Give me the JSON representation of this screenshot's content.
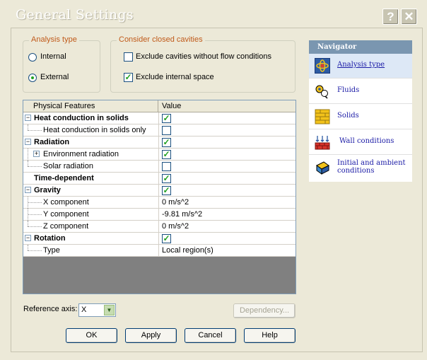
{
  "window": {
    "title": "General Settings",
    "help_glyph": "?",
    "close_glyph": "✕"
  },
  "analysis_type": {
    "legend": "Analysis type",
    "options": [
      {
        "label": "Internal",
        "selected": false
      },
      {
        "label": "External",
        "selected": true
      }
    ]
  },
  "closed_cavities": {
    "legend": "Consider closed cavities",
    "options": [
      {
        "label": "Exclude cavities without flow conditions",
        "checked": false
      },
      {
        "label": "Exclude internal space",
        "checked": true
      }
    ]
  },
  "features_grid": {
    "columns": [
      "Physical Features",
      "Value"
    ],
    "rows": [
      {
        "label": "Heat conduction in solids",
        "value": "",
        "checked": true
      },
      {
        "label": "Heat conduction in solids only",
        "value": "",
        "checked": false
      },
      {
        "label": "Radiation",
        "value": "",
        "checked": true
      },
      {
        "label": "Environment radiation",
        "value": "",
        "checked": true
      },
      {
        "label": "Solar radiation",
        "value": "",
        "checked": false
      },
      {
        "label": "Time-dependent",
        "value": "",
        "checked": true
      },
      {
        "label": "Gravity",
        "value": "",
        "checked": true
      },
      {
        "label": "X component",
        "value": "0 m/s^2"
      },
      {
        "label": "Y component",
        "value": "-9.81 m/s^2"
      },
      {
        "label": "Z component",
        "value": "0 m/s^2"
      },
      {
        "label": "Rotation",
        "value": "",
        "checked": true
      },
      {
        "label": "Type",
        "value": "Local region(s)"
      }
    ]
  },
  "reference_axis": {
    "label": "Reference axis:",
    "value": "X"
  },
  "buttons": {
    "dependency": "Dependency...",
    "ok": "OK",
    "apply": "Apply",
    "cancel": "Cancel",
    "help": "Help"
  },
  "navigator": {
    "title": "Navigator",
    "items": [
      {
        "label": "Analysis type",
        "active": true
      },
      {
        "label": "Fluids",
        "active": false
      },
      {
        "label": "Solids",
        "active": false
      },
      {
        "label": "Wall conditions",
        "active": false
      },
      {
        "label": "Initial and ambient conditions",
        "active": false
      }
    ]
  },
  "colors": {
    "accent_legend": "#c05a1a",
    "check_green": "#21a121",
    "nav_header": "#7a96b0",
    "nav_link": "#1a1aa6"
  }
}
